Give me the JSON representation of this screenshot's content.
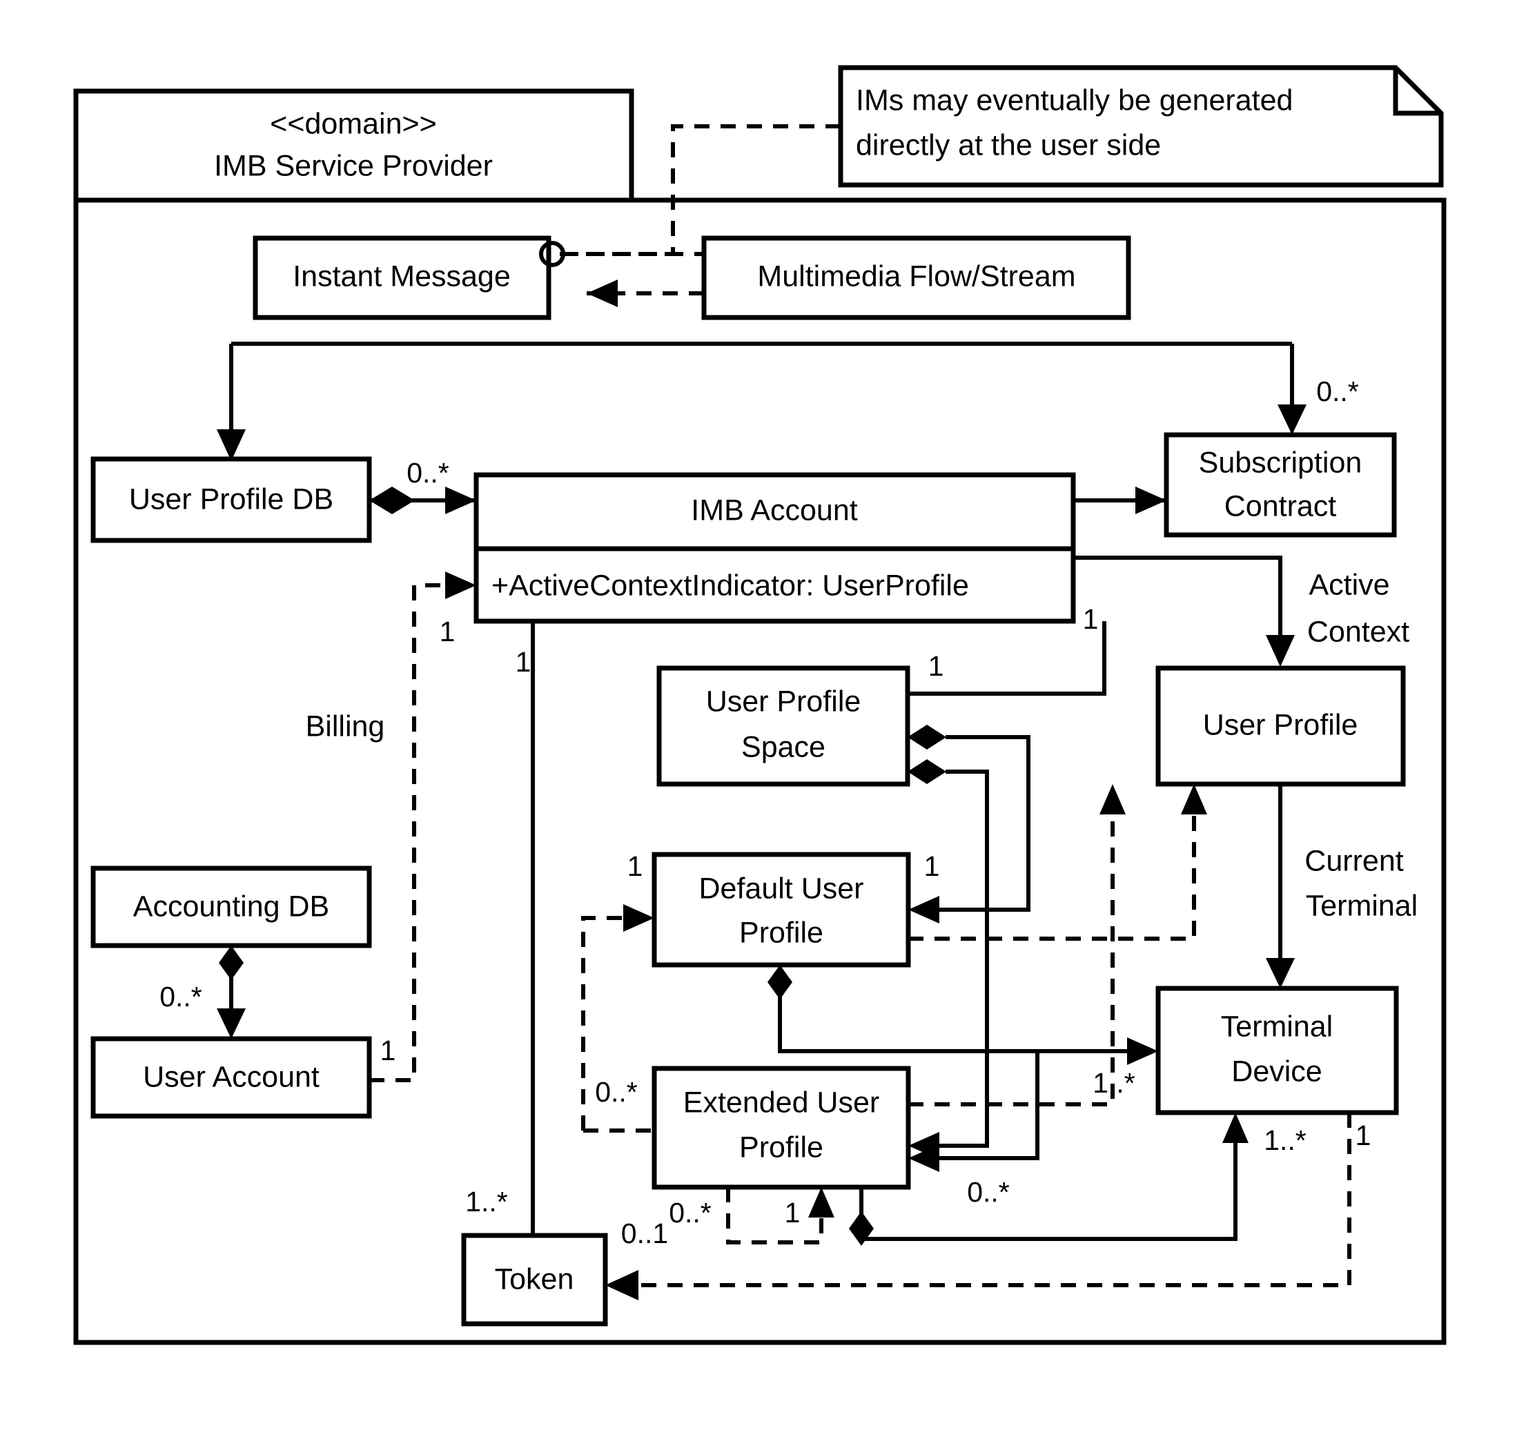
{
  "diagram": {
    "type": "uml-class-diagram",
    "package": {
      "stereotype": "<<domain>>",
      "name": "IMB Service Provider"
    },
    "note": {
      "line1": "IMs may eventually be generated",
      "line2": "directly at the user side"
    },
    "classes": [
      {
        "id": "instant-message",
        "line1": "Instant Message",
        "line2": ""
      },
      {
        "id": "multimedia-flow-stream",
        "line1": "Multimedia Flow/Stream",
        "line2": ""
      },
      {
        "id": "user-profile-db",
        "line1": "User Profile DB",
        "line2": ""
      },
      {
        "id": "imb-account",
        "line1": "IMB Account",
        "line2": "",
        "attribute": "+ActiveContextIndicator: UserProfile"
      },
      {
        "id": "subscription-contract",
        "line1": "Subscription",
        "line2": "Contract"
      },
      {
        "id": "user-profile",
        "line1": "User Profile",
        "line2": ""
      },
      {
        "id": "user-profile-space",
        "line1": "User Profile",
        "line2": "Space"
      },
      {
        "id": "default-user-profile",
        "line1": "Default User",
        "line2": "Profile"
      },
      {
        "id": "extended-user-profile",
        "line1": "Extended User",
        "line2": "Profile"
      },
      {
        "id": "terminal-device",
        "line1": "Terminal",
        "line2": "Device"
      },
      {
        "id": "accounting-db",
        "line1": "Accounting DB",
        "line2": ""
      },
      {
        "id": "user-account",
        "line1": "User Account",
        "line2": ""
      },
      {
        "id": "token",
        "line1": "Token",
        "line2": ""
      }
    ],
    "role_labels": [
      {
        "id": "billing",
        "text": "Billing"
      },
      {
        "id": "active-context-1",
        "text": "Active"
      },
      {
        "id": "active-context-2",
        "text": "Context"
      },
      {
        "id": "current-terminal-1",
        "text": "Current"
      },
      {
        "id": "current-terminal-2",
        "text": "Terminal"
      }
    ],
    "multiplicities": [
      {
        "id": "m-subcontract-top",
        "text": "0..*"
      },
      {
        "id": "m-updb-imbaccount",
        "text": "0..*"
      },
      {
        "id": "m-imbaccount-billing",
        "text": "1"
      },
      {
        "id": "m-imbaccount-token",
        "text": "1"
      },
      {
        "id": "m-imbaccount-right",
        "text": "1"
      },
      {
        "id": "m-ups-right",
        "text": "1"
      },
      {
        "id": "m-dup-right",
        "text": "1"
      },
      {
        "id": "m-dup-left",
        "text": "1"
      },
      {
        "id": "m-accdb-useraccount",
        "text": "0..*"
      },
      {
        "id": "m-useraccount-billing",
        "text": "1"
      },
      {
        "id": "m-eup-left",
        "text": "0..*"
      },
      {
        "id": "m-eup-terminal",
        "text": "0..*"
      },
      {
        "id": "m-terminal-left",
        "text": "1..*"
      },
      {
        "id": "m-terminal-bottom-1",
        "text": "1..*"
      },
      {
        "id": "m-terminal-bottom-2",
        "text": "1"
      },
      {
        "id": "m-token-left",
        "text": "1..*"
      },
      {
        "id": "m-token-right",
        "text": "0..1"
      },
      {
        "id": "m-eup-bottom-1",
        "text": "0..*"
      },
      {
        "id": "m-eup-bottom-2",
        "text": "1"
      }
    ]
  }
}
